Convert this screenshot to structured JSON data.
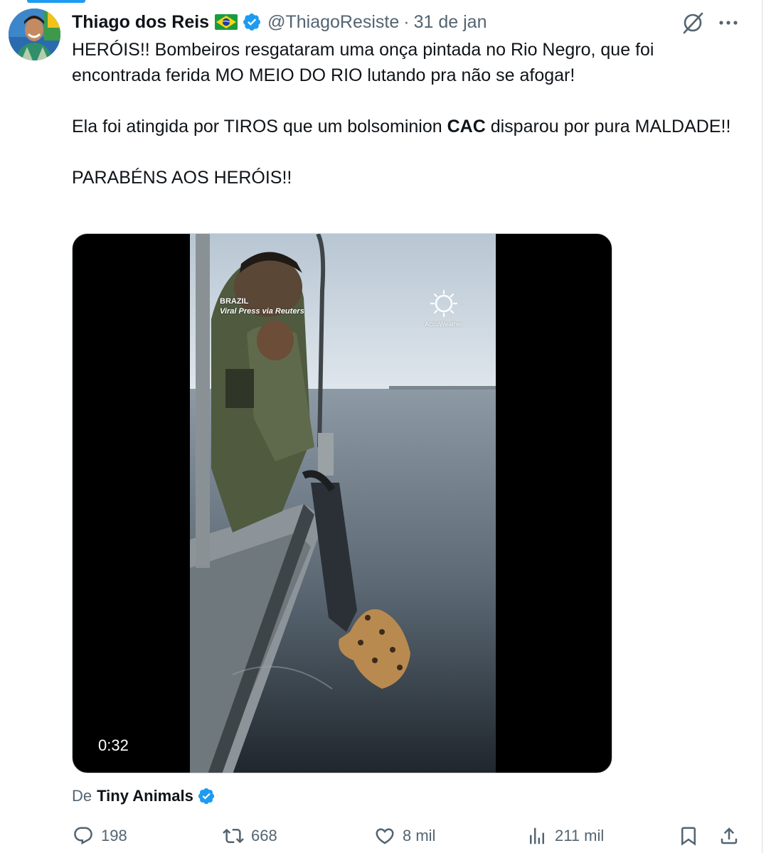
{
  "tweet": {
    "display_name": "Thiago dos Reis",
    "handle": "@ThiagoResiste",
    "separator": "·",
    "date": "31 de jan",
    "text_lines": {
      "p1": "HERÓIS!! Bombeiros resgataram uma onça pintada no Rio Negro, que foi encontrada ferida MO MEIO DO RIO lutando pra não se afogar!",
      "p2_before": "Ela foi atingida por TIROS que um bolsominion ",
      "p2_bold": "CAC",
      "p2_after": " disparou por pura MALDADE!!",
      "p3": "PARABÉNS AOS HERÓIS!!"
    }
  },
  "media": {
    "duration": "0:32",
    "overlay_country": "BRAZIL",
    "overlay_credit": "Viral Press via Reuters",
    "brand": "AccuWeather"
  },
  "source": {
    "prefix": "De",
    "name": "Tiny Animals"
  },
  "actions": {
    "replies": "198",
    "retweets": "668",
    "likes": "8 mil",
    "views": "211 mil"
  },
  "colors": {
    "text": "#0f1419",
    "secondary": "#536471",
    "verified": "#1d9bf0",
    "media_bg": "#000000"
  },
  "icons": [
    "verified-badge-icon",
    "brazil-flag-icon",
    "grok-icon",
    "more-icon",
    "reply-icon",
    "retweet-icon",
    "like-icon",
    "views-icon",
    "bookmark-icon",
    "share-icon"
  ]
}
